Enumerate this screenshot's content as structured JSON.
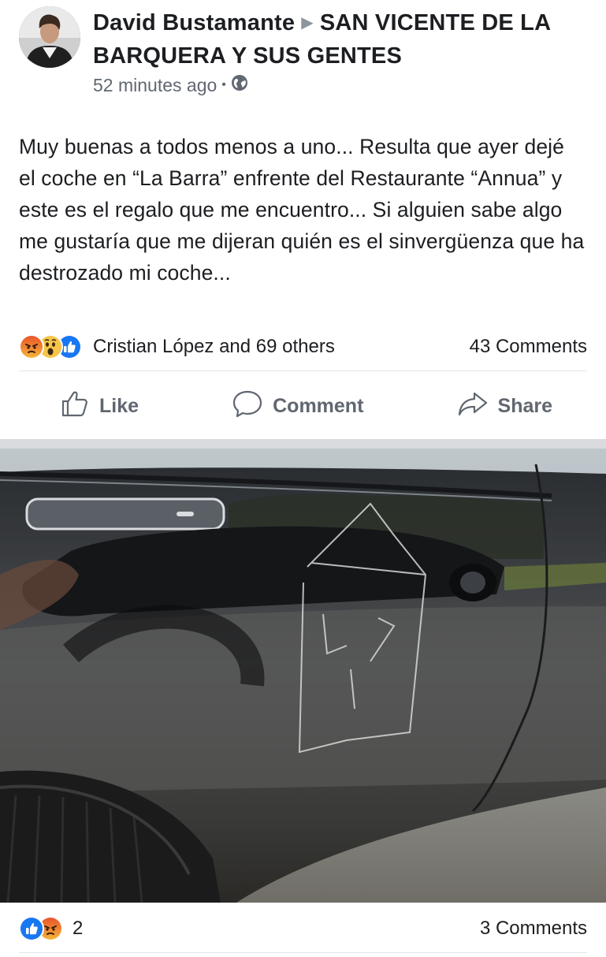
{
  "post": {
    "author": "David Bustamante",
    "group": "SAN VICENTE DE LA BARQUERA Y SUS GENTES",
    "time": "52 minutes ago",
    "privacy_icon": "globe-icon",
    "text": "Muy buenas a todos menos a uno... Resulta que ayer dejé el coche en “La Barra” enfrente del Restaurante “Annua” y este es el regalo que me encuentro... Si alguien sabe algo me gustaría que me dijeran quién es el sinvergüenza que ha destrozado mi coche...",
    "reactions": {
      "icons": [
        "angry-reaction-icon",
        "wow-reaction-icon",
        "like-reaction-icon"
      ],
      "summary": "Cristian López and 69 others"
    },
    "comments_count": "43 Comments",
    "actions": {
      "like": "Like",
      "comment": "Comment",
      "share": "Share"
    }
  },
  "photo_footer": {
    "reaction_icons": [
      "like-reaction-icon",
      "angry-reaction-icon"
    ],
    "reaction_count": "2",
    "comments_count": "3 Comments"
  },
  "colors": {
    "like_blue": "#1877f2",
    "angry_orange": "#f0632a",
    "wow_yellow": "#f7c54a",
    "secondary_text": "#606770",
    "divider": "#e4e6eb"
  }
}
